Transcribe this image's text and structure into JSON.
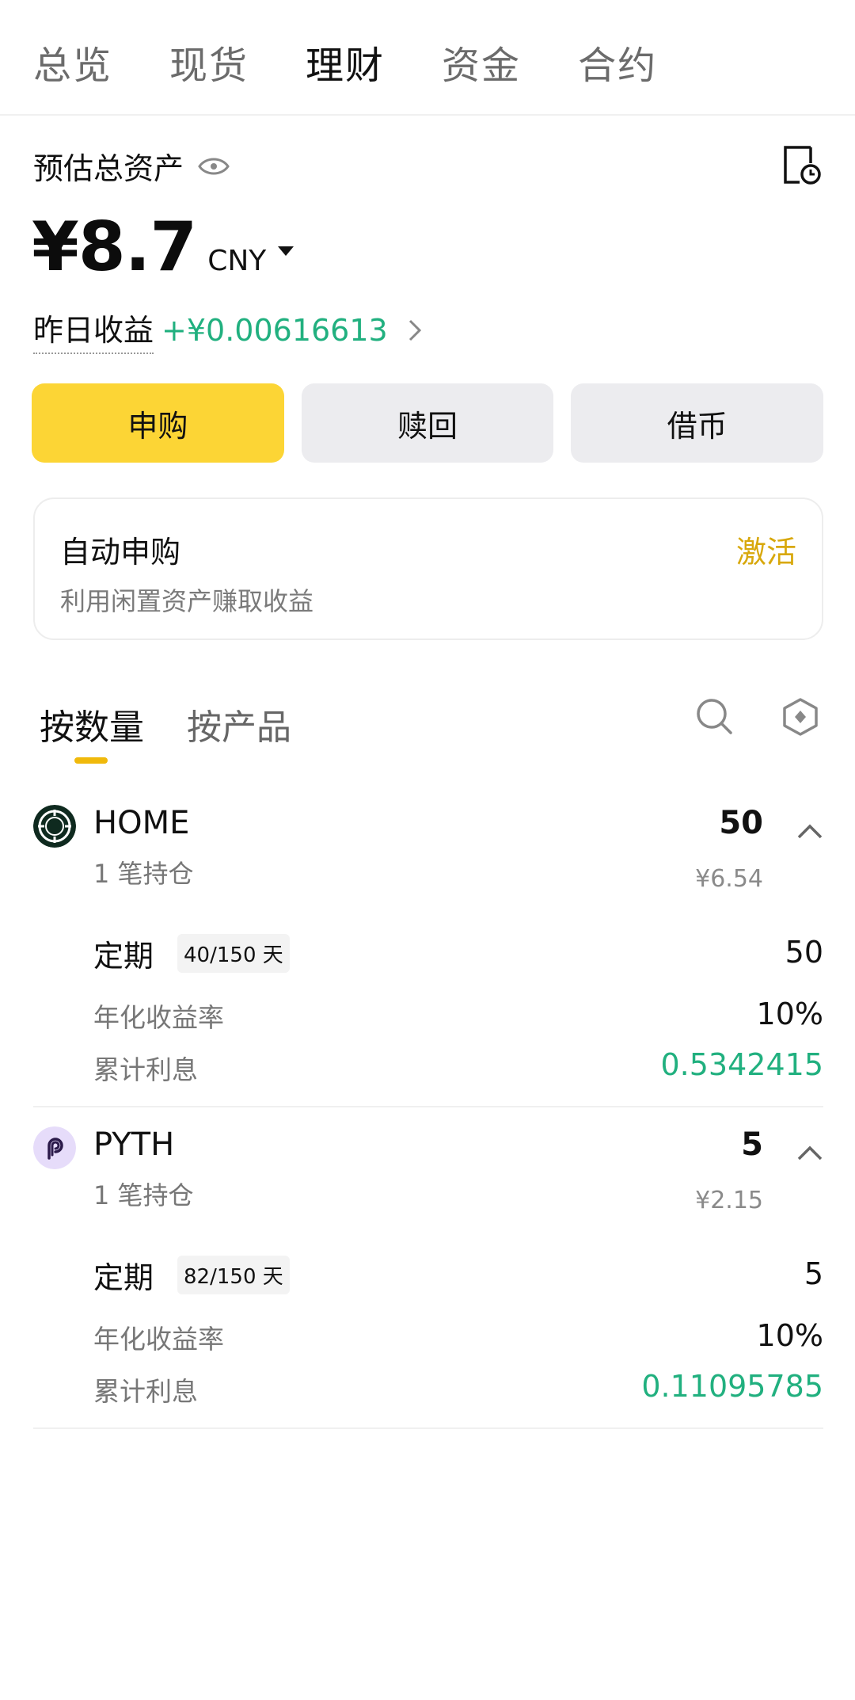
{
  "top_tabs": [
    {
      "label": "总览"
    },
    {
      "label": "现货"
    },
    {
      "label": "理财"
    },
    {
      "label": "资金"
    },
    {
      "label": "合约"
    }
  ],
  "header": {
    "asset_label": "预估总资产",
    "asset_value": "¥8.7",
    "currency": "CNY",
    "yesterday_label": "昨日收益",
    "yesterday_value": "+¥0.00616613"
  },
  "actions": {
    "subscribe": "申购",
    "redeem": "赎回",
    "borrow": "借币"
  },
  "auto_card": {
    "title": "自动申购",
    "subtitle": "利用闲置资产赚取收益",
    "activate": "激活"
  },
  "sub_tabs": {
    "by_quantity": "按数量",
    "by_product": "按产品"
  },
  "holdings": [
    {
      "coin": "HOME",
      "positions": "1 笔持仓",
      "amount": "50",
      "fiat": "¥6.54",
      "product_type": "定期",
      "days": "40/150 天",
      "product_amount": "50",
      "apr_label": "年化收益率",
      "apr": "10%",
      "interest_label": "累计利息",
      "interest": "0.5342415"
    },
    {
      "coin": "PYTH",
      "positions": "1 笔持仓",
      "amount": "5",
      "fiat": "¥2.15",
      "product_type": "定期",
      "days": "82/150 天",
      "product_amount": "5",
      "apr_label": "年化收益率",
      "apr": "10%",
      "interest_label": "累计利息",
      "interest": "0.11095785"
    }
  ],
  "colors": {
    "primary": "#fcd535",
    "green": "#21b07f",
    "activate": "#d8a80c"
  }
}
